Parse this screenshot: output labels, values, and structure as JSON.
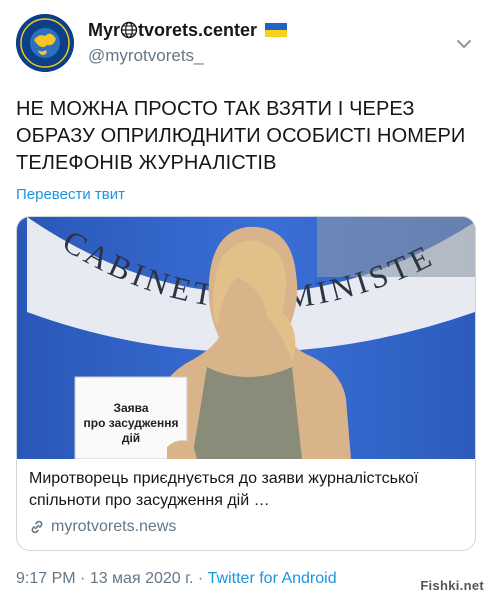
{
  "header": {
    "display_name_prefix": "Myr",
    "display_name_suffix": "tvorets.center",
    "handle": "@myrotvorets_"
  },
  "tweet": {
    "text": "НЕ МОЖНА ПРОСТО ТАК ВЗЯТИ І ЧЕРЕЗ ОБРАЗУ ОПРИЛЮДНИТИ ОСОБИСТІ НОМЕРИ ТЕЛЕФОНІВ ЖУРНАЛІСТІВ",
    "translate_label": "Перевести твит"
  },
  "card": {
    "image_banner_text": "CABINET OF MINISTERS OF UKRAINE",
    "sign_line1": "Заява",
    "sign_line2": "про засудження",
    "sign_line3": "дій",
    "title": "Миротворець приєднується до заяви журналістської спільноти про засудження дій …",
    "domain": "myrotvorets.news"
  },
  "meta": {
    "time": "9:17 PM",
    "separator": " · ",
    "date": "13 мая 2020 г.",
    "separator2": " · ",
    "source": "Twitter for Android"
  },
  "watermark": "Fishki.net",
  "colors": {
    "accent": "#1b95e0",
    "muted": "#657786",
    "flag_blue": "#1f63c6",
    "flag_yellow": "#f7d21b",
    "avatar_bg": "#0b3f86"
  }
}
